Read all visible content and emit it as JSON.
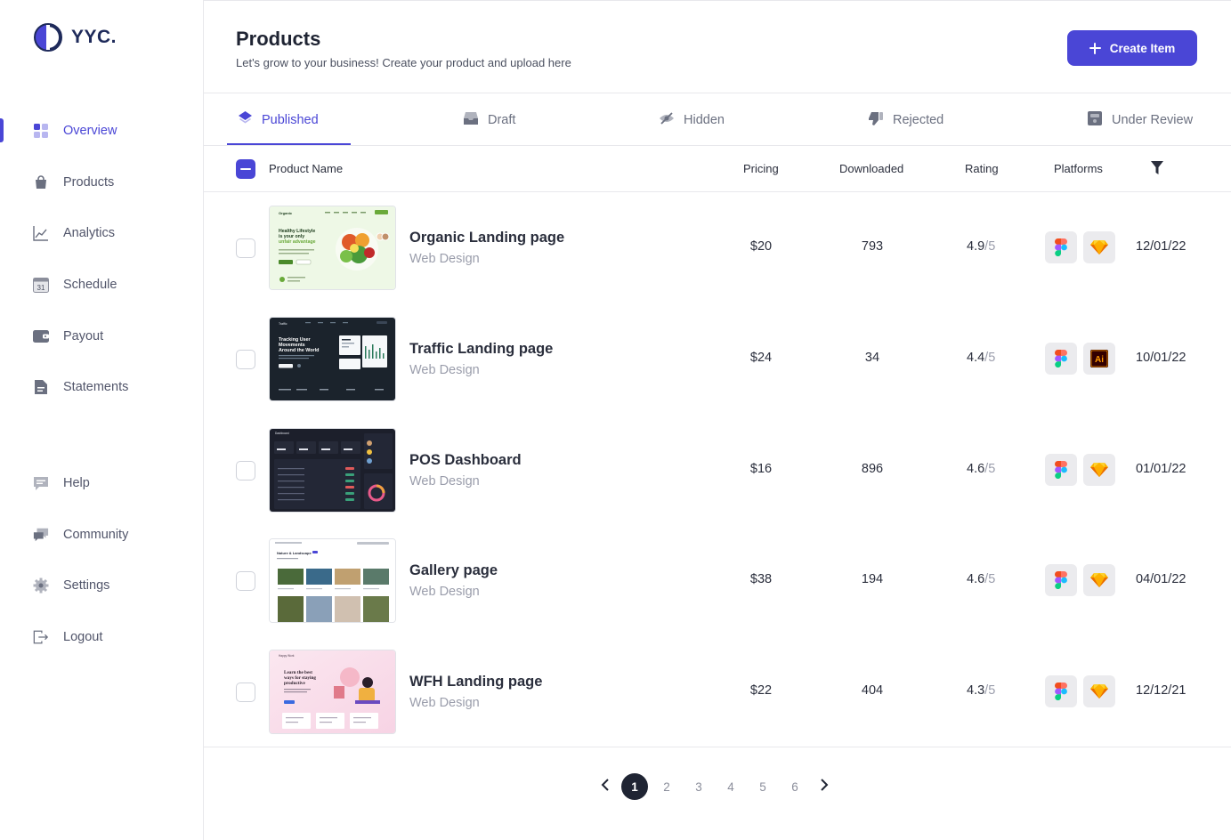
{
  "brand": {
    "name": "YYC."
  },
  "sidebar": {
    "items": [
      {
        "label": "Overview",
        "icon": "grid-icon",
        "active": true
      },
      {
        "label": "Products",
        "icon": "bag-icon"
      },
      {
        "label": "Analytics",
        "icon": "chart-line-icon"
      },
      {
        "label": "Schedule",
        "icon": "calendar-icon",
        "calendar_day": "31"
      },
      {
        "label": "Payout",
        "icon": "wallet-icon"
      },
      {
        "label": "Statements",
        "icon": "document-icon"
      },
      {
        "label": "Help",
        "icon": "chat-icon"
      },
      {
        "label": "Community",
        "icon": "community-icon"
      },
      {
        "label": "Settings",
        "icon": "gear-icon"
      },
      {
        "label": "Logout",
        "icon": "logout-icon"
      }
    ]
  },
  "header": {
    "title": "Products",
    "subtitle": "Let's grow to your business! Create your product and upload here",
    "create_label": "Create Item"
  },
  "tabs": [
    {
      "label": "Published",
      "icon": "layers-icon",
      "active": true
    },
    {
      "label": "Draft",
      "icon": "inbox-icon"
    },
    {
      "label": "Hidden",
      "icon": "eye-off-icon"
    },
    {
      "label": "Rejected",
      "icon": "thumbs-down-icon"
    },
    {
      "label": "Under Review",
      "icon": "review-box-icon"
    }
  ],
  "table": {
    "columns": {
      "name": "Product Name",
      "pricing": "Pricing",
      "downloaded": "Downloaded",
      "rating": "Rating",
      "platforms": "Platforms"
    },
    "filter_icon": "filter-icon",
    "rows": [
      {
        "name": "Organic Landing page",
        "category": "Web Design",
        "price": "$20",
        "downloaded": "793",
        "rating": "4.9",
        "rating_total": "/5",
        "platforms": [
          "figma-icon",
          "sketch-icon"
        ],
        "date": "12/01/22",
        "thumb": {
          "theme": "light-green",
          "brand": "Organic",
          "headline": "Healthy Lifestyle is your only unfair advantage"
        }
      },
      {
        "name": "Traffic Landing page",
        "category": "Web Design",
        "price": "$24",
        "downloaded": "34",
        "rating": "4.4",
        "rating_total": "/5",
        "platforms": [
          "figma-icon",
          "illustrator-icon"
        ],
        "date": "10/01/22",
        "thumb": {
          "theme": "dark",
          "brand": "Traffic",
          "headline": "Tracking User Movements Around the World"
        }
      },
      {
        "name": "POS Dashboard",
        "category": "Web Design",
        "price": "$16",
        "downloaded": "896",
        "rating": "4.6",
        "rating_total": "/5",
        "platforms": [
          "figma-icon",
          "sketch-icon"
        ],
        "date": "01/01/22",
        "thumb": {
          "theme": "dashboard",
          "brand": "Dashboard",
          "headline": ""
        }
      },
      {
        "name": "Gallery page",
        "category": "Web Design",
        "price": "$38",
        "downloaded": "194",
        "rating": "4.6",
        "rating_total": "/5",
        "platforms": [
          "figma-icon",
          "sketch-icon"
        ],
        "date": "04/01/22",
        "thumb": {
          "theme": "gallery",
          "brand": "",
          "headline": "Nature & Landscape"
        }
      },
      {
        "name": "WFH Landing page",
        "category": "Web Design",
        "price": "$22",
        "downloaded": "404",
        "rating": "4.3",
        "rating_total": "/5",
        "platforms": [
          "figma-icon",
          "sketch-icon"
        ],
        "date": "12/12/21",
        "thumb": {
          "theme": "pink",
          "brand": "Happy Work",
          "headline": "Learn the best ways for staying productive"
        }
      }
    ]
  },
  "pagination": {
    "pages": [
      "1",
      "2",
      "3",
      "4",
      "5",
      "6"
    ],
    "current": "1"
  },
  "colors": {
    "accent": "#4a46d6",
    "text": "#1f2433",
    "muted": "#9a9dab"
  }
}
